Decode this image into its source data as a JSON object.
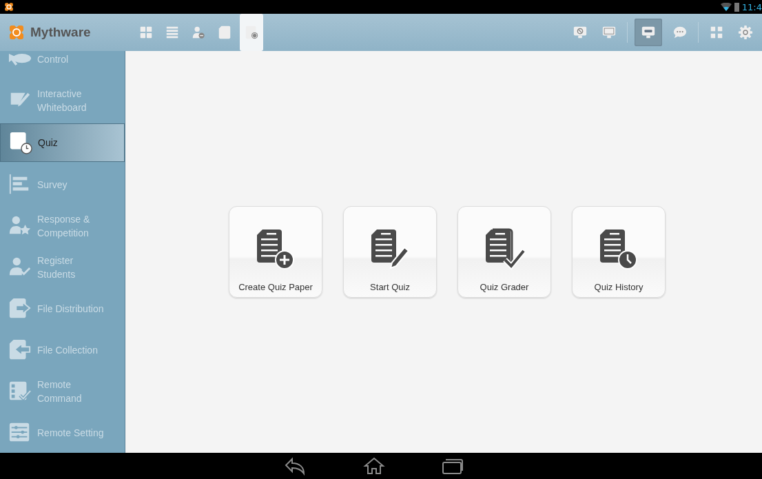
{
  "status_bar": {
    "time": "11:4"
  },
  "app": {
    "title": "Mythware"
  },
  "toolbar_left": [
    {
      "selected": false
    },
    {
      "selected": false
    },
    {
      "selected": false
    },
    {
      "selected": false
    },
    {
      "selected": true
    }
  ],
  "toolbar_right": [
    {
      "selected": false
    },
    {
      "selected": false
    },
    {
      "selected": true
    },
    {
      "selected": false
    },
    {
      "selected": false
    },
    {
      "selected": false
    }
  ],
  "sidebar": {
    "items": [
      {
        "label": "Control",
        "selected": false
      },
      {
        "label": "Interactive\nWhiteboard",
        "selected": false
      },
      {
        "label": "Quiz",
        "selected": true
      },
      {
        "label": "Survey",
        "selected": false
      },
      {
        "label": "Response &\nCompetition",
        "selected": false
      },
      {
        "label": "Register\nStudents",
        "selected": false
      },
      {
        "label": "File Distribution",
        "selected": false
      },
      {
        "label": "File Collection",
        "selected": false
      },
      {
        "label": "Remote\nCommand",
        "selected": false
      },
      {
        "label": "Remote Setting",
        "selected": false
      }
    ]
  },
  "actions": [
    {
      "label": "Create Quiz Paper"
    },
    {
      "label": "Start Quiz"
    },
    {
      "label": "Quiz Grader"
    },
    {
      "label": "Quiz History"
    }
  ]
}
